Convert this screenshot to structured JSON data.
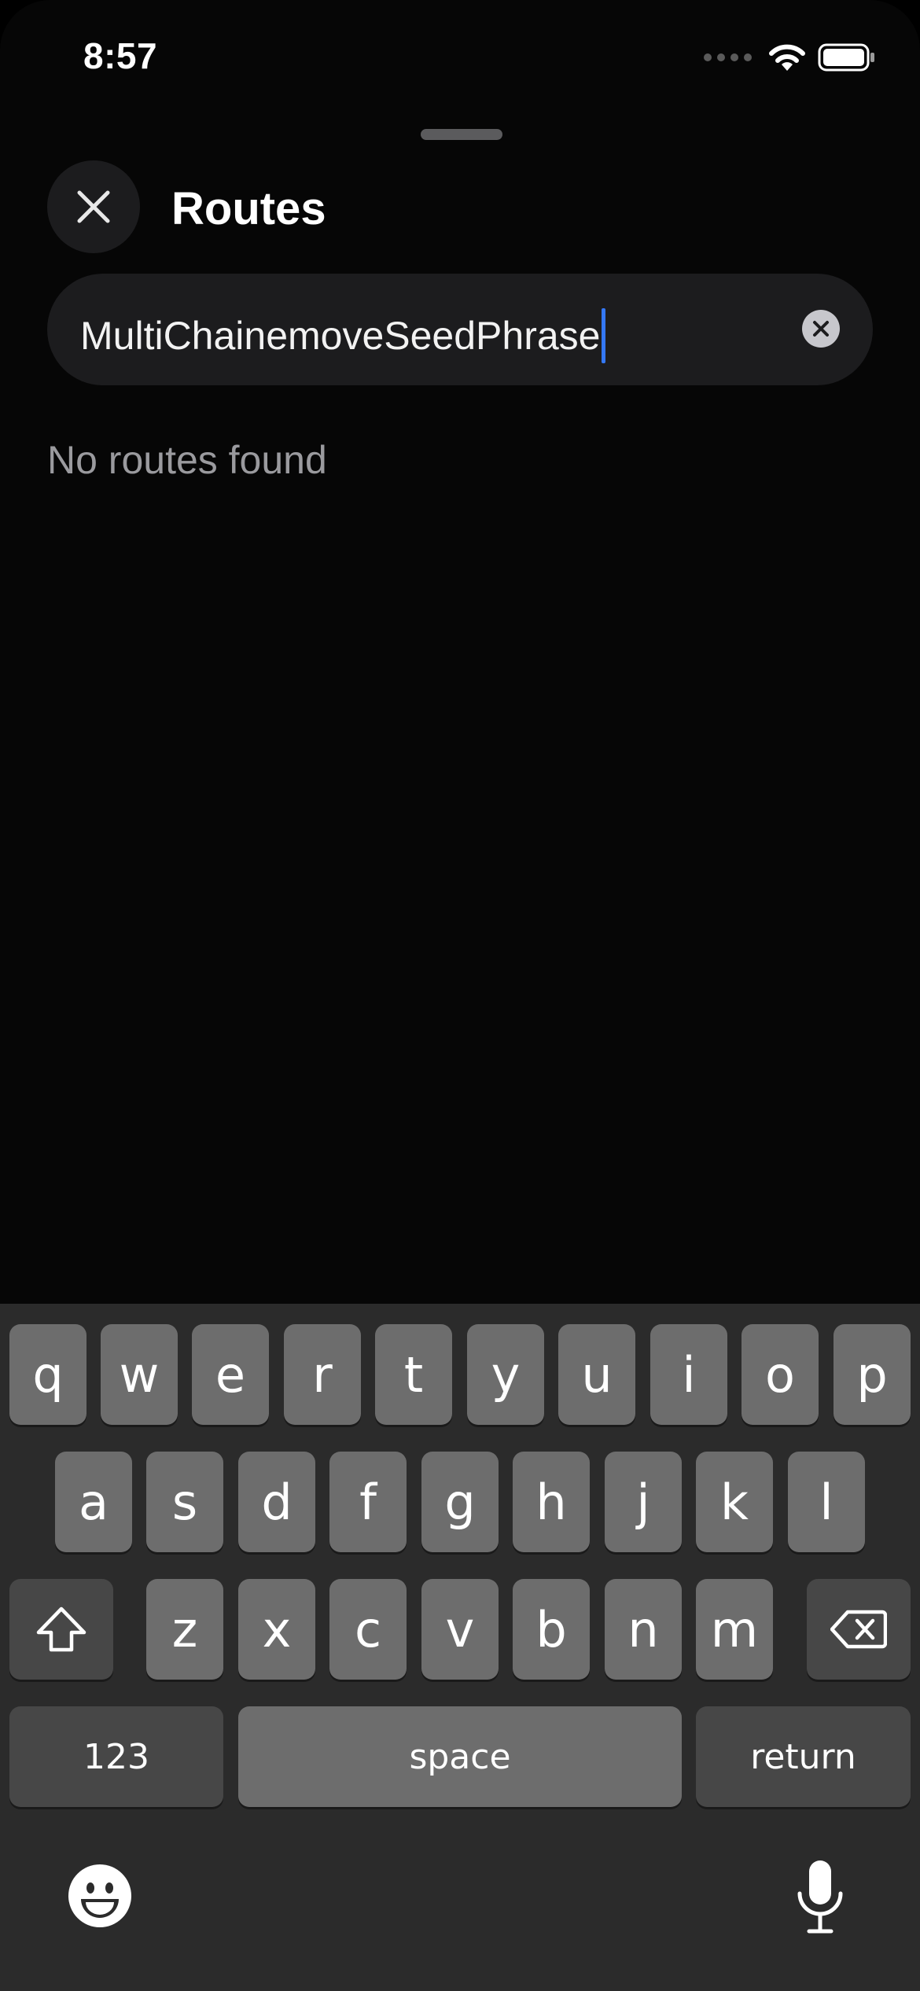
{
  "status_bar": {
    "time": "8:57"
  },
  "header": {
    "title": "Routes"
  },
  "search": {
    "value": "MultiChainemoveSeedPhrase"
  },
  "results": {
    "empty_text": "No routes found"
  },
  "keyboard": {
    "row1": [
      "q",
      "w",
      "e",
      "r",
      "t",
      "y",
      "u",
      "i",
      "o",
      "p"
    ],
    "row2": [
      "a",
      "s",
      "d",
      "f",
      "g",
      "h",
      "j",
      "k",
      "l"
    ],
    "row3": [
      "z",
      "x",
      "c",
      "v",
      "b",
      "n",
      "m"
    ],
    "numbers_label": "123",
    "space_label": "space",
    "return_label": "return"
  },
  "colors": {
    "accent_caret": "#3478f6",
    "background": "#000000"
  },
  "icons": [
    "close-icon",
    "clear-icon",
    "wifi-icon",
    "battery-icon",
    "shift-icon",
    "backspace-icon",
    "emoji-icon",
    "microphone-icon"
  ]
}
